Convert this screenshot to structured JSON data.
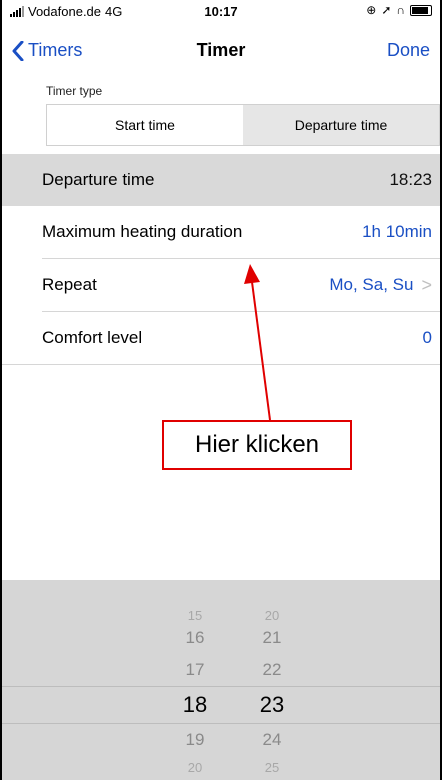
{
  "status_bar": {
    "carrier": "Vodafone.de",
    "network": "4G",
    "time": "10:17"
  },
  "nav": {
    "back_label": "Timers",
    "title": "Timer",
    "done_label": "Done"
  },
  "timer_type": {
    "label": "Timer type",
    "options": [
      "Start time",
      "Departure time"
    ],
    "selected": "Departure time"
  },
  "rows": [
    {
      "label": "Departure time",
      "value": "18:23"
    },
    {
      "label": "Maximum heating duration",
      "value": "1h 10min"
    },
    {
      "label": "Repeat",
      "value": "Mo, Sa, Su"
    },
    {
      "label": "Comfort level",
      "value": "0"
    }
  ],
  "picker": {
    "hours": [
      "15",
      "16",
      "17",
      "18",
      "19",
      "20"
    ],
    "minutes": [
      "20",
      "21",
      "22",
      "23",
      "24",
      "25"
    ],
    "selected_hour": "18",
    "selected_minute": "23"
  },
  "annotation": {
    "text": "Hier klicken",
    "color": "#e00000"
  },
  "colors": {
    "accent": "#1a4fc4",
    "selected_row": "#d9d9d9",
    "picker_bg": "#d6d6d6"
  }
}
